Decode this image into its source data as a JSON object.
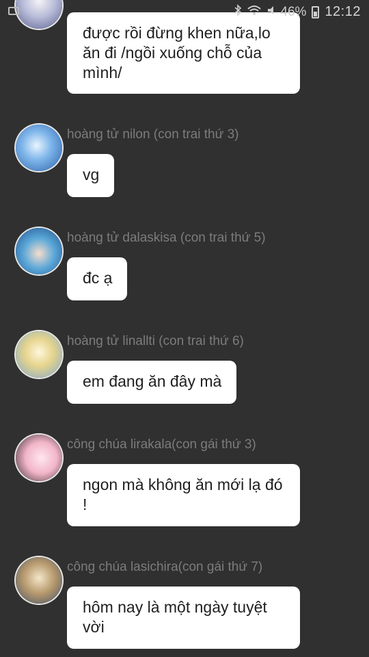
{
  "status_bar": {
    "battery_percent": "46%",
    "time": "12:12",
    "icons": [
      "image-icon",
      "bluetooth-icon",
      "wifi-icon",
      "mute-icon",
      "battery-icon"
    ]
  },
  "messages": [
    {
      "sender": "",
      "text": "được rồi đừng khen nữa,lo ăn đi /ngồi xuống chỗ của mình/",
      "avatar": "avatar-silver-hair"
    },
    {
      "sender": "hoàng tử nilon  (con trai thứ 3)",
      "text": "vg",
      "avatar": "avatar-blue-boy"
    },
    {
      "sender": "hoàng tử dalaskisa (con trai thứ 5)",
      "text": "đc ạ",
      "avatar": "avatar-blue-hair"
    },
    {
      "sender": "hoàng tử linallti (con trai thứ 6)",
      "text": "em đang ăn đây mà",
      "avatar": "avatar-blond-boy"
    },
    {
      "sender": "công chúa lirakala(con gái thứ 3)",
      "text": "ngon mà không ăn mới lạ đó !",
      "avatar": "avatar-pink-girl"
    },
    {
      "sender": "công chúa lasichira(con gái thứ 7)",
      "text": "hôm nay là một ngày tuyệt vời",
      "avatar": "avatar-blonde-girl"
    }
  ],
  "colors": {
    "background": "#303030",
    "bubble": "#ffffff",
    "sender_text": "#7c7c7c",
    "message_text": "#202020"
  }
}
